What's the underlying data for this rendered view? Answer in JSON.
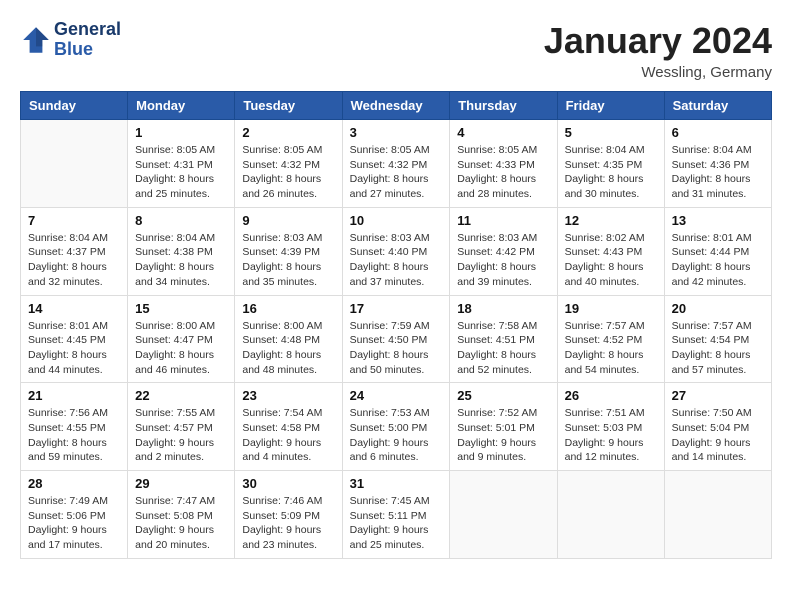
{
  "header": {
    "logo_line1": "General",
    "logo_line2": "Blue",
    "month_title": "January 2024",
    "location": "Wessling, Germany"
  },
  "weekdays": [
    "Sunday",
    "Monday",
    "Tuesday",
    "Wednesday",
    "Thursday",
    "Friday",
    "Saturday"
  ],
  "weeks": [
    [
      {
        "day": "",
        "sunrise": "",
        "sunset": "",
        "daylight": ""
      },
      {
        "day": "1",
        "sunrise": "Sunrise: 8:05 AM",
        "sunset": "Sunset: 4:31 PM",
        "daylight": "Daylight: 8 hours and 25 minutes."
      },
      {
        "day": "2",
        "sunrise": "Sunrise: 8:05 AM",
        "sunset": "Sunset: 4:32 PM",
        "daylight": "Daylight: 8 hours and 26 minutes."
      },
      {
        "day": "3",
        "sunrise": "Sunrise: 8:05 AM",
        "sunset": "Sunset: 4:32 PM",
        "daylight": "Daylight: 8 hours and 27 minutes."
      },
      {
        "day": "4",
        "sunrise": "Sunrise: 8:05 AM",
        "sunset": "Sunset: 4:33 PM",
        "daylight": "Daylight: 8 hours and 28 minutes."
      },
      {
        "day": "5",
        "sunrise": "Sunrise: 8:04 AM",
        "sunset": "Sunset: 4:35 PM",
        "daylight": "Daylight: 8 hours and 30 minutes."
      },
      {
        "day": "6",
        "sunrise": "Sunrise: 8:04 AM",
        "sunset": "Sunset: 4:36 PM",
        "daylight": "Daylight: 8 hours and 31 minutes."
      }
    ],
    [
      {
        "day": "7",
        "sunrise": "Sunrise: 8:04 AM",
        "sunset": "Sunset: 4:37 PM",
        "daylight": "Daylight: 8 hours and 32 minutes."
      },
      {
        "day": "8",
        "sunrise": "Sunrise: 8:04 AM",
        "sunset": "Sunset: 4:38 PM",
        "daylight": "Daylight: 8 hours and 34 minutes."
      },
      {
        "day": "9",
        "sunrise": "Sunrise: 8:03 AM",
        "sunset": "Sunset: 4:39 PM",
        "daylight": "Daylight: 8 hours and 35 minutes."
      },
      {
        "day": "10",
        "sunrise": "Sunrise: 8:03 AM",
        "sunset": "Sunset: 4:40 PM",
        "daylight": "Daylight: 8 hours and 37 minutes."
      },
      {
        "day": "11",
        "sunrise": "Sunrise: 8:03 AM",
        "sunset": "Sunset: 4:42 PM",
        "daylight": "Daylight: 8 hours and 39 minutes."
      },
      {
        "day": "12",
        "sunrise": "Sunrise: 8:02 AM",
        "sunset": "Sunset: 4:43 PM",
        "daylight": "Daylight: 8 hours and 40 minutes."
      },
      {
        "day": "13",
        "sunrise": "Sunrise: 8:01 AM",
        "sunset": "Sunset: 4:44 PM",
        "daylight": "Daylight: 8 hours and 42 minutes."
      }
    ],
    [
      {
        "day": "14",
        "sunrise": "Sunrise: 8:01 AM",
        "sunset": "Sunset: 4:45 PM",
        "daylight": "Daylight: 8 hours and 44 minutes."
      },
      {
        "day": "15",
        "sunrise": "Sunrise: 8:00 AM",
        "sunset": "Sunset: 4:47 PM",
        "daylight": "Daylight: 8 hours and 46 minutes."
      },
      {
        "day": "16",
        "sunrise": "Sunrise: 8:00 AM",
        "sunset": "Sunset: 4:48 PM",
        "daylight": "Daylight: 8 hours and 48 minutes."
      },
      {
        "day": "17",
        "sunrise": "Sunrise: 7:59 AM",
        "sunset": "Sunset: 4:50 PM",
        "daylight": "Daylight: 8 hours and 50 minutes."
      },
      {
        "day": "18",
        "sunrise": "Sunrise: 7:58 AM",
        "sunset": "Sunset: 4:51 PM",
        "daylight": "Daylight: 8 hours and 52 minutes."
      },
      {
        "day": "19",
        "sunrise": "Sunrise: 7:57 AM",
        "sunset": "Sunset: 4:52 PM",
        "daylight": "Daylight: 8 hours and 54 minutes."
      },
      {
        "day": "20",
        "sunrise": "Sunrise: 7:57 AM",
        "sunset": "Sunset: 4:54 PM",
        "daylight": "Daylight: 8 hours and 57 minutes."
      }
    ],
    [
      {
        "day": "21",
        "sunrise": "Sunrise: 7:56 AM",
        "sunset": "Sunset: 4:55 PM",
        "daylight": "Daylight: 8 hours and 59 minutes."
      },
      {
        "day": "22",
        "sunrise": "Sunrise: 7:55 AM",
        "sunset": "Sunset: 4:57 PM",
        "daylight": "Daylight: 9 hours and 2 minutes."
      },
      {
        "day": "23",
        "sunrise": "Sunrise: 7:54 AM",
        "sunset": "Sunset: 4:58 PM",
        "daylight": "Daylight: 9 hours and 4 minutes."
      },
      {
        "day": "24",
        "sunrise": "Sunrise: 7:53 AM",
        "sunset": "Sunset: 5:00 PM",
        "daylight": "Daylight: 9 hours and 6 minutes."
      },
      {
        "day": "25",
        "sunrise": "Sunrise: 7:52 AM",
        "sunset": "Sunset: 5:01 PM",
        "daylight": "Daylight: 9 hours and 9 minutes."
      },
      {
        "day": "26",
        "sunrise": "Sunrise: 7:51 AM",
        "sunset": "Sunset: 5:03 PM",
        "daylight": "Daylight: 9 hours and 12 minutes."
      },
      {
        "day": "27",
        "sunrise": "Sunrise: 7:50 AM",
        "sunset": "Sunset: 5:04 PM",
        "daylight": "Daylight: 9 hours and 14 minutes."
      }
    ],
    [
      {
        "day": "28",
        "sunrise": "Sunrise: 7:49 AM",
        "sunset": "Sunset: 5:06 PM",
        "daylight": "Daylight: 9 hours and 17 minutes."
      },
      {
        "day": "29",
        "sunrise": "Sunrise: 7:47 AM",
        "sunset": "Sunset: 5:08 PM",
        "daylight": "Daylight: 9 hours and 20 minutes."
      },
      {
        "day": "30",
        "sunrise": "Sunrise: 7:46 AM",
        "sunset": "Sunset: 5:09 PM",
        "daylight": "Daylight: 9 hours and 23 minutes."
      },
      {
        "day": "31",
        "sunrise": "Sunrise: 7:45 AM",
        "sunset": "Sunset: 5:11 PM",
        "daylight": "Daylight: 9 hours and 25 minutes."
      },
      {
        "day": "",
        "sunrise": "",
        "sunset": "",
        "daylight": ""
      },
      {
        "day": "",
        "sunrise": "",
        "sunset": "",
        "daylight": ""
      },
      {
        "day": "",
        "sunrise": "",
        "sunset": "",
        "daylight": ""
      }
    ]
  ]
}
